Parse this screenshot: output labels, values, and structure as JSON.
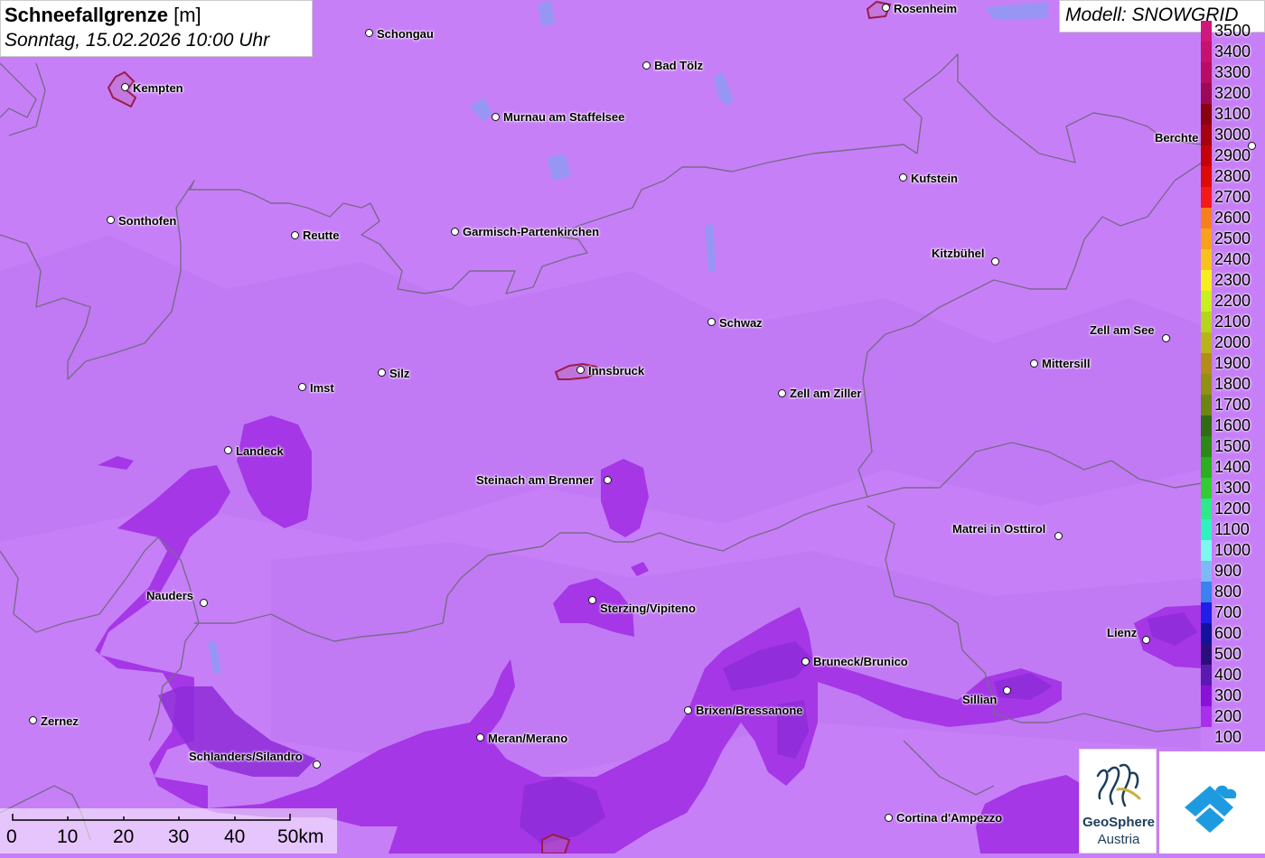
{
  "title": {
    "param": "Schneefallgrenze",
    "unit": "[m]",
    "datetime": "Sonntag, 15.02.2026 10:00 Uhr"
  },
  "model": "Modell: SNOWGRID",
  "legend": [
    {
      "label": "3500",
      "color": "#d0177b"
    },
    {
      "label": "3400",
      "color": "#c8106f"
    },
    {
      "label": "3300",
      "color": "#b80d63"
    },
    {
      "label": "3200",
      "color": "#9c0a55"
    },
    {
      "label": "3100",
      "color": "#8a0210"
    },
    {
      "label": "3000",
      "color": "#a5020f"
    },
    {
      "label": "2900",
      "color": "#c4000c"
    },
    {
      "label": "2800",
      "color": "#dd0a0a"
    },
    {
      "label": "2700",
      "color": "#f51a1a"
    },
    {
      "label": "2600",
      "color": "#f77f1d"
    },
    {
      "label": "2500",
      "color": "#f8a11c"
    },
    {
      "label": "2400",
      "color": "#f8c11d"
    },
    {
      "label": "2300",
      "color": "#f6ef1e"
    },
    {
      "label": "2200",
      "color": "#c8ef1f"
    },
    {
      "label": "2100",
      "color": "#b7d41c"
    },
    {
      "label": "2000",
      "color": "#b9b31a"
    },
    {
      "label": "1900",
      "color": "#b38c19"
    },
    {
      "label": "1800",
      "color": "#938f14"
    },
    {
      "label": "1700",
      "color": "#6d8512"
    },
    {
      "label": "1600",
      "color": "#326c12"
    },
    {
      "label": "1500",
      "color": "#2a8a16"
    },
    {
      "label": "1400",
      "color": "#2bae1f"
    },
    {
      "label": "1300",
      "color": "#33cc33"
    },
    {
      "label": "1200",
      "color": "#2cea8a"
    },
    {
      "label": "1100",
      "color": "#2ef2bf"
    },
    {
      "label": "1000",
      "color": "#7df8f0"
    },
    {
      "label": "900",
      "color": "#7fb9f3"
    },
    {
      "label": "800",
      "color": "#3b82ee"
    },
    {
      "label": "700",
      "color": "#1f1fe8"
    },
    {
      "label": "600",
      "color": "#12129a"
    },
    {
      "label": "500",
      "color": "#2a0f7a"
    },
    {
      "label": "400",
      "color": "#5a1ab0"
    },
    {
      "label": "300",
      "color": "#8a12d8"
    },
    {
      "label": "200",
      "color": "#a830e8"
    },
    {
      "label": "100",
      "color": "#c77ff8"
    }
  ],
  "cities": [
    {
      "name": "Schongau"
    },
    {
      "name": "Rosenheim"
    },
    {
      "name": "Kempten"
    },
    {
      "name": "Bad Tölz"
    },
    {
      "name": "Murnau am Staffelsee"
    },
    {
      "name": "Berchte"
    },
    {
      "name": "Kufstein"
    },
    {
      "name": "Sonthofen"
    },
    {
      "name": "Reutte"
    },
    {
      "name": "Garmisch-Partenkirchen"
    },
    {
      "name": "Kitzbühel"
    },
    {
      "name": "Schwaz"
    },
    {
      "name": "Zell am See"
    },
    {
      "name": "Mittersill"
    },
    {
      "name": "Silz"
    },
    {
      "name": "Innsbruck"
    },
    {
      "name": "Imst"
    },
    {
      "name": "Zell am Ziller"
    },
    {
      "name": "Landeck"
    },
    {
      "name": "Steinach am Brenner"
    },
    {
      "name": "Matrei in Osttirol"
    },
    {
      "name": "Nauders"
    },
    {
      "name": "Sterzing/Vipiteno"
    },
    {
      "name": "Lienz"
    },
    {
      "name": "Bruneck/Brunico"
    },
    {
      "name": "Sillian"
    },
    {
      "name": "Brixen/Bressanone"
    },
    {
      "name": "Zernez"
    },
    {
      "name": "Meran/Merano"
    },
    {
      "name": "Schlanders/Silandro"
    },
    {
      "name": "Cortina d'Ampezzo"
    }
  ],
  "scalebar": {
    "ticks": [
      "0",
      "10",
      "20",
      "30",
      "40",
      "50km"
    ]
  },
  "logo": {
    "line1": "GeoSphere",
    "line2": "Austria"
  }
}
